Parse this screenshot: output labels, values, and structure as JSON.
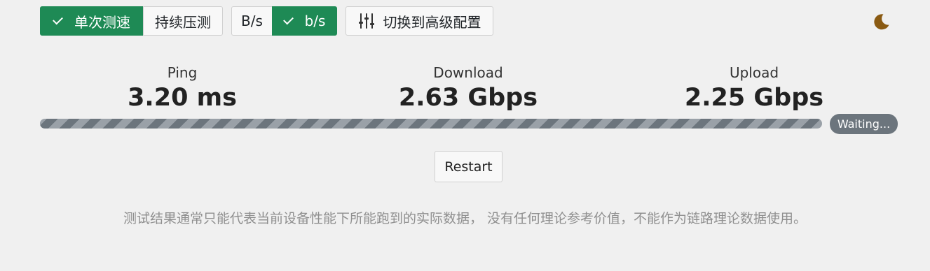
{
  "toolbar": {
    "mode_single_label": "单次测速",
    "mode_stress_label": "持续压测",
    "unit_bytes_label": "B/s",
    "unit_bits_label": "b/s",
    "advanced_label": "切换到高级配置"
  },
  "theme": {
    "toggle_icon": "moon-icon",
    "icon_color": "#8a5a12"
  },
  "stats": {
    "ping": {
      "label": "Ping",
      "value": "3.20 ms"
    },
    "download": {
      "label": "Download",
      "value": "2.63 Gbps"
    },
    "upload": {
      "label": "Upload",
      "value": "2.25 Gbps"
    }
  },
  "progress": {
    "fraction": 0,
    "status": "Waiting..."
  },
  "actions": {
    "restart_label": "Restart"
  },
  "disclaimer": "测试结果通常只能代表当前设备性能下所能跑到的实际数据， 没有任何理论参考价值，不能作为链路理论数据使用。",
  "colors": {
    "accent": "#1e8a55",
    "badge": "#6c757d",
    "background": "#f0f0f0"
  }
}
